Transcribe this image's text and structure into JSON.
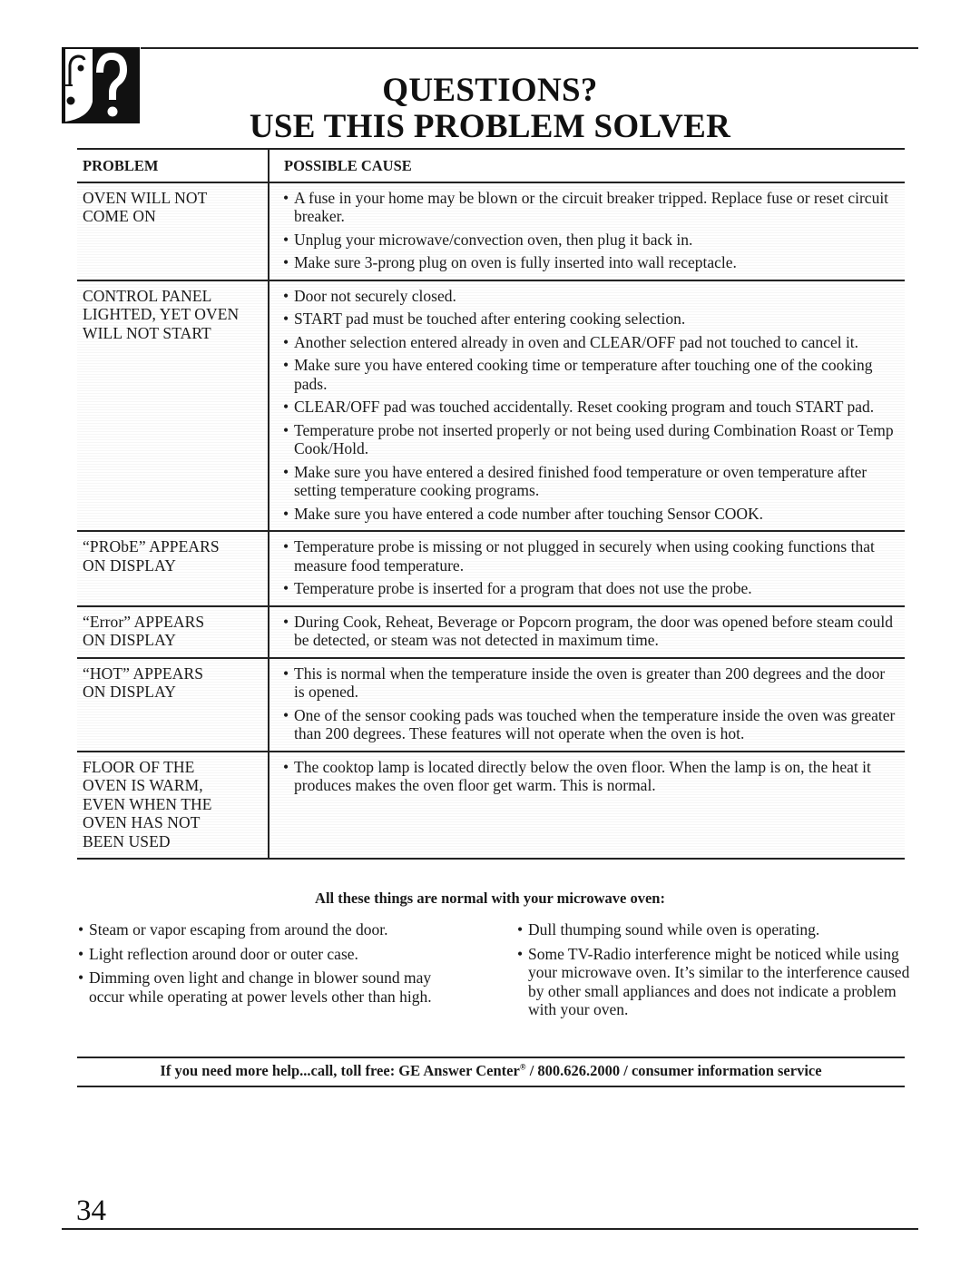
{
  "header": {
    "logo_icon": "question-face-icon",
    "title_line1": "QUESTIONS?",
    "title_line2": "USE THIS PROBLEM SOLVER"
  },
  "table": {
    "columns": [
      "PROBLEM",
      "POSSIBLE CAUSE"
    ],
    "rows": [
      {
        "problem": [
          "OVEN WILL NOT",
          "COME ON"
        ],
        "causes": [
          "A fuse in your home may be blown or the circuit breaker tripped. Replace fuse or reset circuit breaker.",
          "Unplug your microwave/convection oven, then plug it back in.",
          "Make sure 3-prong plug on oven is fully inserted into wall receptacle."
        ]
      },
      {
        "problem": [
          "CONTROL PANEL",
          "LIGHTED, YET OVEN",
          "WILL NOT START"
        ],
        "causes": [
          "Door not securely closed.",
          "START pad must be touched after entering cooking selection.",
          "Another selection entered already in oven and CLEAR/OFF pad not touched to cancel it.",
          "Make sure you have entered cooking time or temperature after touching one of the cooking pads.",
          "CLEAR/OFF pad was touched accidentally. Reset cooking program and touch START pad.",
          "Temperature probe not inserted properly or not being used during Combination Roast or Temp Cook/Hold.",
          "Make sure you have entered a desired finished food temperature or oven temperature after setting temperature cooking programs.",
          "Make sure you have entered a code number after touching Sensor COOK."
        ]
      },
      {
        "problem": [
          "“PRObE” APPEARS",
          "ON DISPLAY"
        ],
        "causes": [
          "Temperature probe is missing or not plugged in securely when using cooking functions that measure food temperature.",
          "Temperature probe is inserted for a program that does not use the probe."
        ]
      },
      {
        "problem": [
          "“Error” APPEARS",
          "ON DISPLAY"
        ],
        "causes": [
          "During Cook, Reheat, Beverage or Popcorn program, the door was opened before steam could be detected, or steam was not detected in maximum time."
        ]
      },
      {
        "problem": [
          "“HOT” APPEARS",
          "ON DISPLAY"
        ],
        "causes": [
          "This is normal when the temperature inside the oven is greater than 200 degrees and the door is opened.",
          "One of the sensor cooking pads was touched when the temperature inside the oven was greater than 200 degrees. These features will not operate when the oven is hot."
        ]
      },
      {
        "problem": [
          "FLOOR OF THE",
          "OVEN IS WARM,",
          "EVEN WHEN THE",
          "OVEN HAS NOT",
          "BEEN USED"
        ],
        "causes": [
          "The cooktop lamp is located directly below the oven floor. When the lamp is on, the heat it produces makes the oven floor get warm. This is normal."
        ]
      }
    ]
  },
  "normal": {
    "heading": "All these things are normal with your microwave oven:",
    "left_items": [
      "Steam or vapor escaping from around the door.",
      "Light reflection around door or outer case.",
      "Dimming oven light and change in blower sound may occur while operating at power levels other than high."
    ],
    "right_items": [
      "Dull thumping sound while oven is operating.",
      "Some TV-Radio interference might be noticed while using your microwave oven. It’s similar to the interference caused by other small appliances and does not indicate a problem with your oven."
    ]
  },
  "help": {
    "prefix": "If you need more help...call, toll free: GE Answer Center",
    "registered": "®",
    "suffix": " / 800.626.2000 / consumer information service"
  },
  "page_number": "34",
  "bullet": "•"
}
